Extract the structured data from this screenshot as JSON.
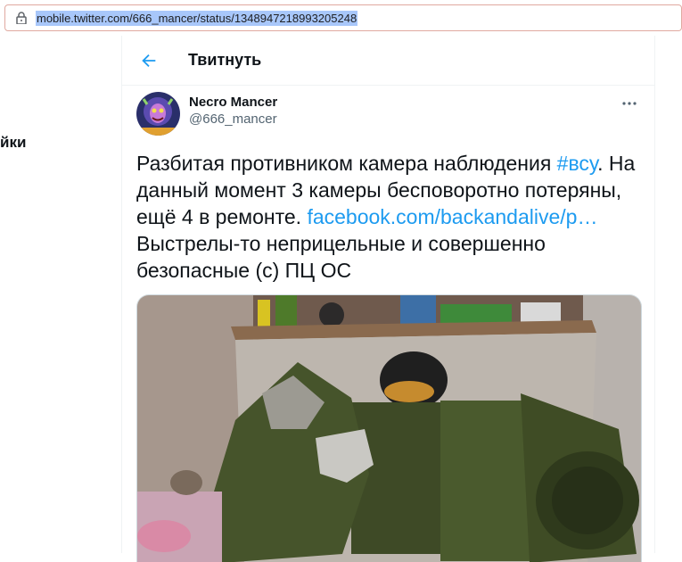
{
  "browser": {
    "url": "mobile.twitter.com/666_mancer/status/1348947218993205248",
    "lock_icon": "lock-icon"
  },
  "left_fragment": "йки",
  "header": {
    "title": "Твитнуть",
    "back_icon": "arrow-left-icon"
  },
  "tweet": {
    "display_name": "Necro Mancer",
    "handle": "@666_mancer",
    "more_icon": "more-horizontal-icon",
    "text_part1": "Разбитая противником камера наблюдения ",
    "hashtag": "#всу",
    "text_part2": ". На данный момент 3 камеры бесповоротно потеряны, ещё 4 в ремонте. ",
    "link": "facebook.com/backandalive/p…",
    "text_part3": " Выстрелы-то неприцельные и совершенно безопасные (с) ПЦ ОС"
  },
  "colors": {
    "accent": "#1d9bf0",
    "text": "#0f1419",
    "secondary": "#536471",
    "url_highlight": "#a8c7fa"
  }
}
